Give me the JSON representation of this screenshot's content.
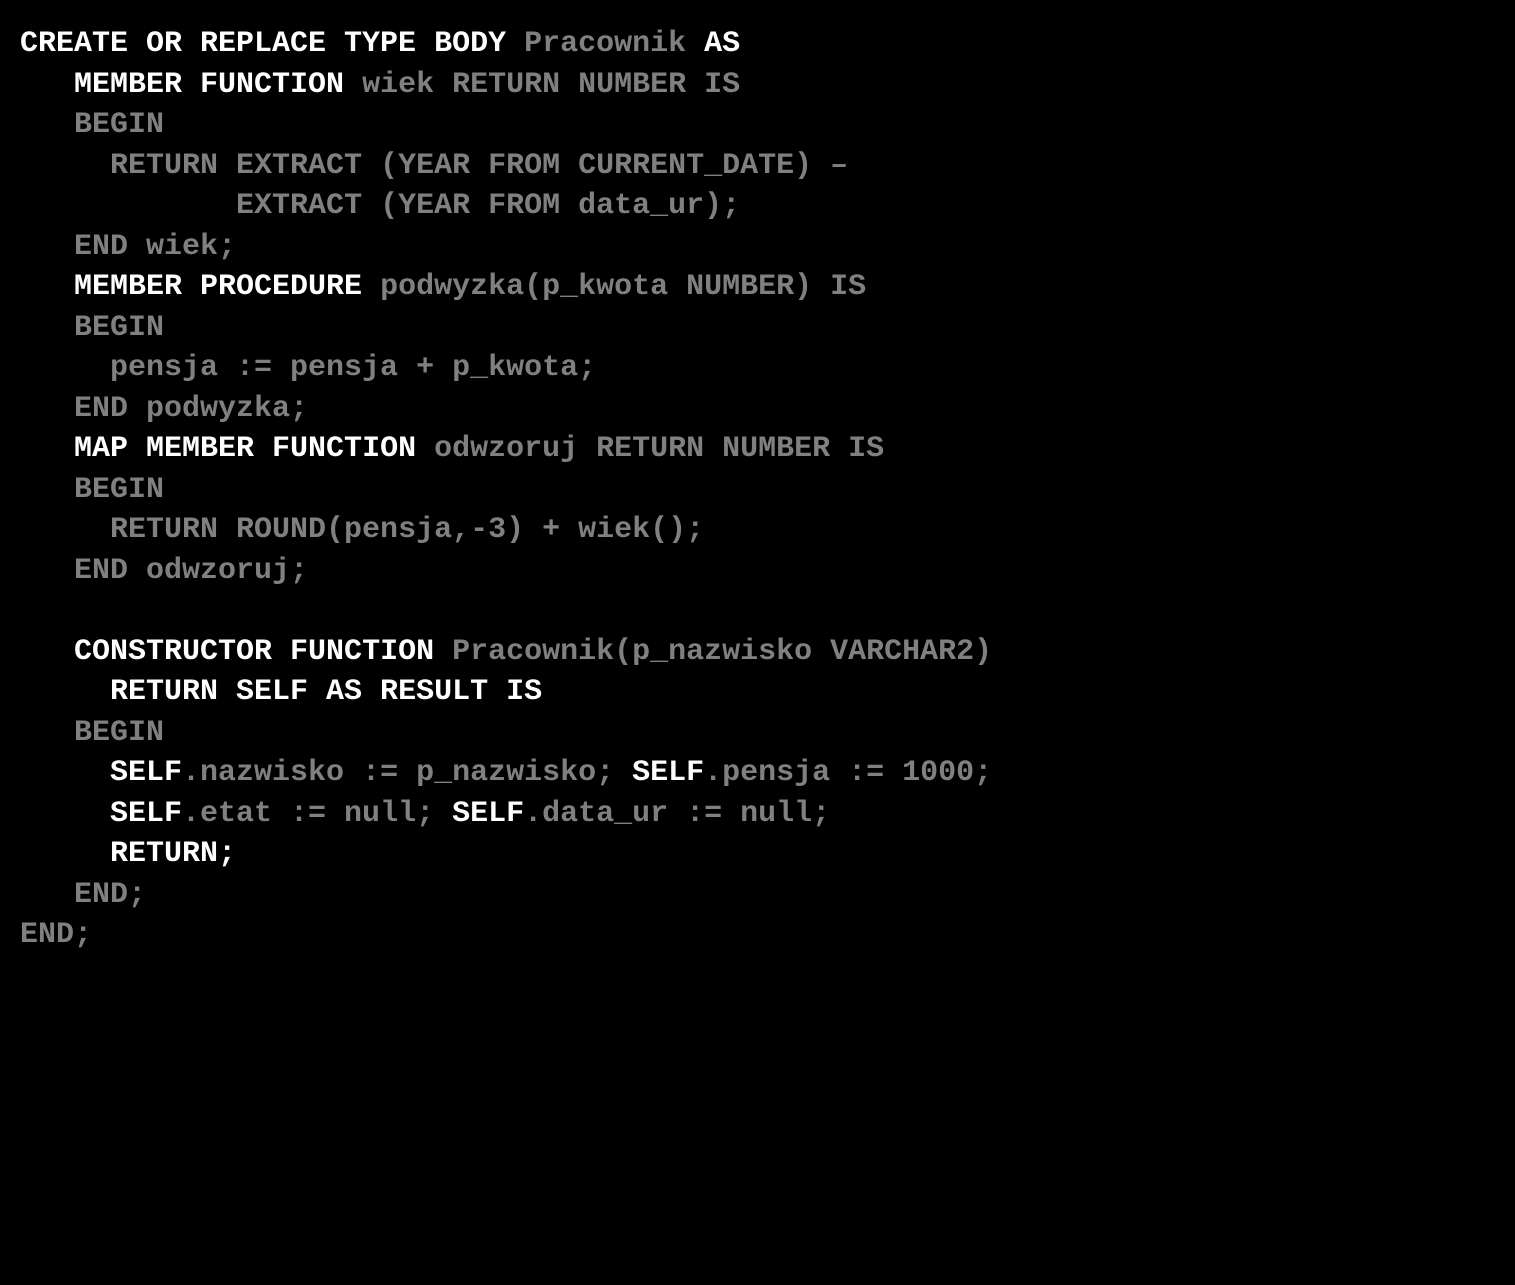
{
  "code": {
    "l1": {
      "kw1": "CREATE OR REPLACE TYPE BODY ",
      "id1": "Pracownik ",
      "kw2": "AS"
    },
    "l2": {
      "sp": "   ",
      "kw1": "MEMBER FUNCTION ",
      "id1": "wiek RETURN NUMBER IS"
    },
    "l3": {
      "sp": "   ",
      "id1": "BEGIN"
    },
    "l4": {
      "sp": "     ",
      "id1": "RETURN EXTRACT (YEAR FROM CURRENT_DATE) –"
    },
    "l5": {
      "sp": "            ",
      "id1": "EXTRACT (YEAR FROM data_ur);"
    },
    "l6": {
      "sp": "   ",
      "id1": "END wiek;"
    },
    "l7": {
      "sp": "   ",
      "kw1": "MEMBER PROCEDURE ",
      "id1": "podwyzka(p_kwota NUMBER) IS"
    },
    "l8": {
      "sp": "   ",
      "id1": "BEGIN"
    },
    "l9": {
      "sp": "     ",
      "id1": "pensja := pensja + p_kwota;"
    },
    "l10": {
      "sp": "   ",
      "id1": "END podwyzka;"
    },
    "l11": {
      "sp": "   ",
      "kw1": "MAP MEMBER FUNCTION ",
      "id1": "odwzoruj RETURN NUMBER IS"
    },
    "l12": {
      "sp": "   ",
      "id1": "BEGIN"
    },
    "l13": {
      "sp": "     ",
      "id1": "RETURN ROUND(pensja,-3) + wiek();"
    },
    "l14": {
      "sp": "   ",
      "id1": "END odwzoruj;"
    },
    "l15": {
      "sp": "   ",
      "kw1": "CONSTRUCTOR FUNCTION ",
      "id1": "Pracownik(p_nazwisko VARCHAR2)"
    },
    "l16": {
      "sp": "     ",
      "kw1": "RETURN SELF AS RESULT IS"
    },
    "l17": {
      "sp": "   ",
      "id1": "BEGIN"
    },
    "l18": {
      "sp": "     ",
      "kw1": "SELF",
      "id1": ".nazwisko := p_nazwisko; ",
      "kw2": "SELF",
      "id2": ".pensja := 1000;"
    },
    "l19": {
      "sp": "     ",
      "kw1": "SELF",
      "id1": ".etat := null; ",
      "kw2": "SELF",
      "id2": ".data_ur := null;"
    },
    "l20": {
      "sp": "     ",
      "kw1": "RETURN;"
    },
    "l21": {
      "sp": "   ",
      "id1": "END;"
    },
    "l22": {
      "id1": "END;"
    }
  }
}
